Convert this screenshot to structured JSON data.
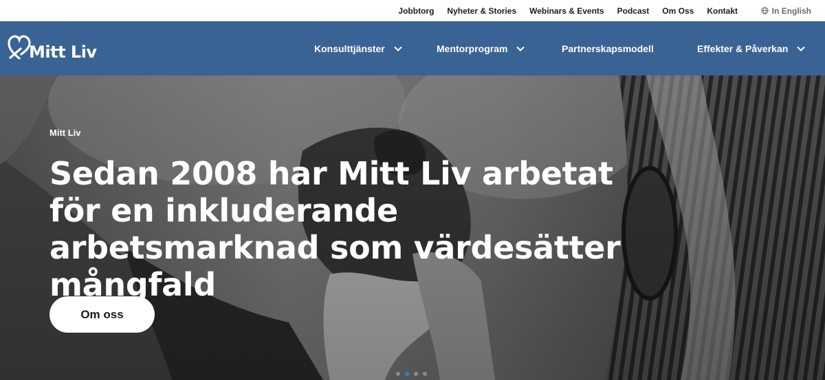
{
  "topbar": {
    "links": [
      "Jobbtorg",
      "Nyheter & Stories",
      "Webinars & Events",
      "Podcast",
      "Om Oss",
      "Kontakt"
    ],
    "language_label": "In English"
  },
  "nav": {
    "logo_text": "Mitt Liv",
    "items": [
      {
        "label": "Konsulttjänster",
        "has_dropdown": true
      },
      {
        "label": "Mentorprogram",
        "has_dropdown": true
      },
      {
        "label": "Partnerskapsmodell",
        "has_dropdown": false
      },
      {
        "label": "Effekter & Påverkan",
        "has_dropdown": true
      }
    ]
  },
  "hero": {
    "eyebrow": "Mitt Liv",
    "title": "Sedan 2008 har Mitt Liv arbetat för en inkluderande arbetsmarknad som värdesätter mångfald",
    "button_label": "Om oss",
    "slides_count": 4,
    "active_slide": 2
  },
  "colors": {
    "nav_bg": "#3a6395",
    "accent_dot": "#2f7fd0",
    "text_dark": "#1c1c1c",
    "white": "#ffffff"
  },
  "icons": [
    "globe-icon",
    "chevron-down-icon",
    "mitt-liv-heart-logo"
  ]
}
